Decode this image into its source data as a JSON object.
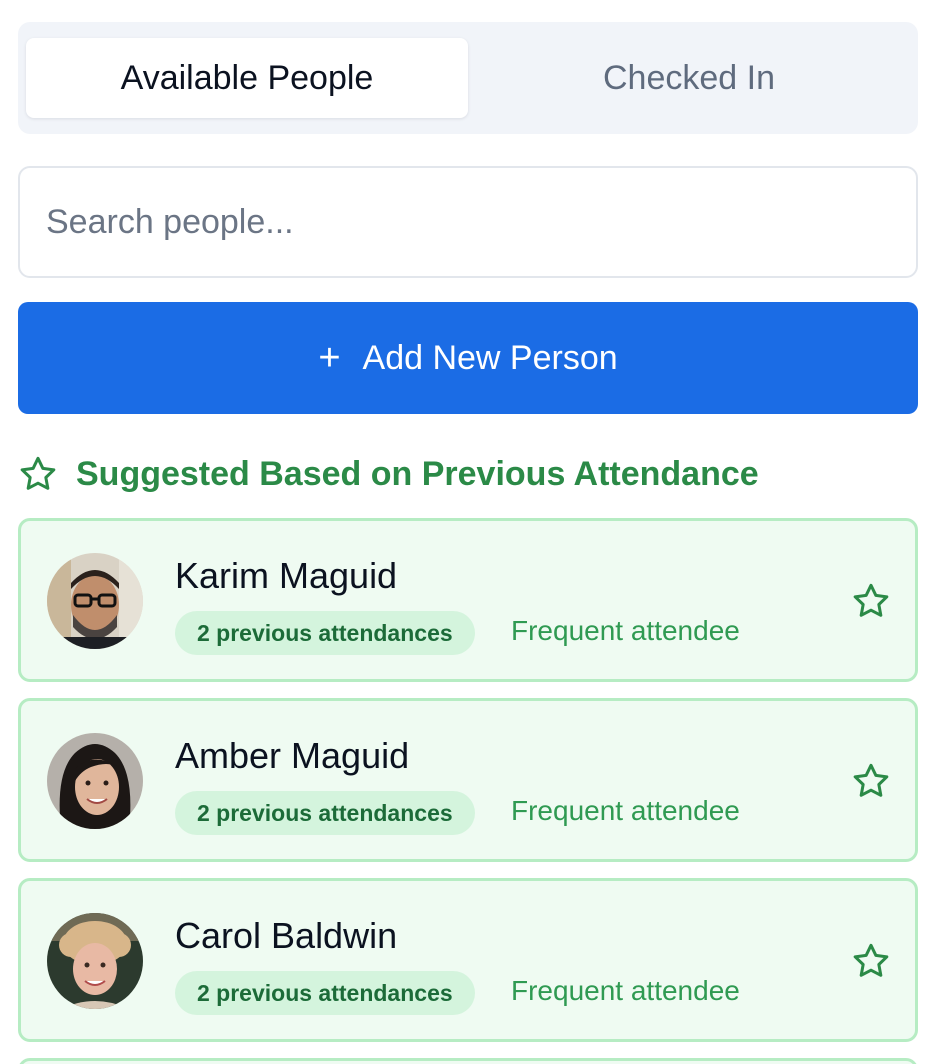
{
  "tabs": [
    {
      "label": "Available People",
      "active": true
    },
    {
      "label": "Checked In",
      "active": false
    }
  ],
  "search": {
    "placeholder": "Search people...",
    "value": ""
  },
  "add_button": {
    "icon": "plus-icon",
    "label": "Add New Person"
  },
  "suggested": {
    "icon": "star-outline-icon",
    "title": "Suggested Based on Previous Attendance",
    "people": [
      {
        "name": "Karim Maguid",
        "attendance": "2 previous attendances",
        "tag": "Frequent attendee",
        "avatar": "avatar-karim"
      },
      {
        "name": "Amber Maguid",
        "attendance": "2 previous attendances",
        "tag": "Frequent attendee",
        "avatar": "avatar-amber"
      },
      {
        "name": "Carol Baldwin",
        "attendance": "2 previous attendances",
        "tag": "Frequent attendee",
        "avatar": "avatar-carol"
      }
    ]
  },
  "colors": {
    "accent": "#1b6ce5",
    "suggest_green": "#2b8a47",
    "card_bg": "#effbf2",
    "card_border": "#b6ecc3",
    "badge_bg": "#d4f4dd"
  }
}
